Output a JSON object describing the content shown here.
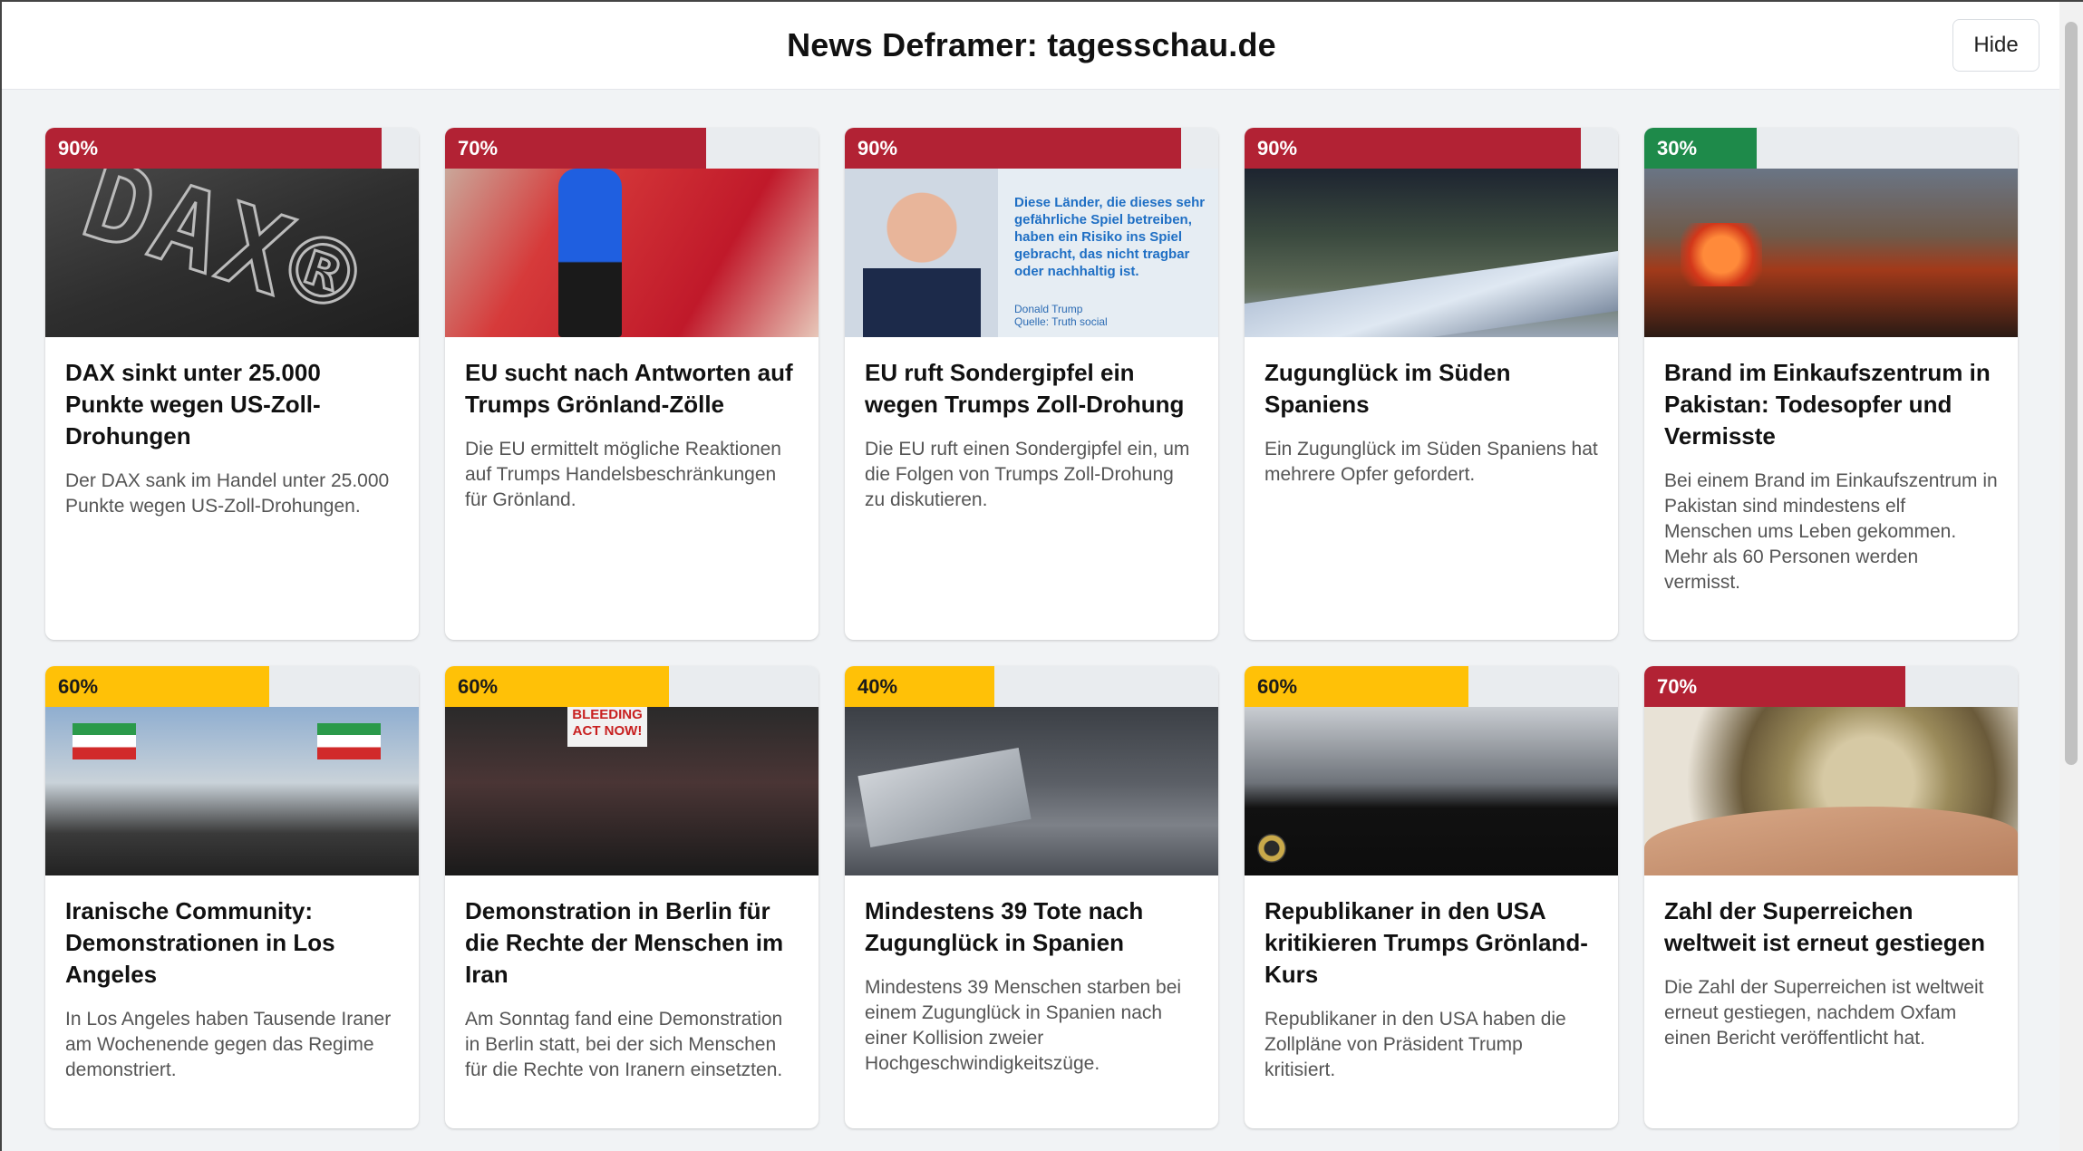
{
  "header": {
    "title": "News Deframer: tagesschau.de",
    "hide_label": "Hide"
  },
  "colors": {
    "high": "#b22234",
    "medium": "#ffc107",
    "low": "#1e8a4a",
    "track": "#e9ecef"
  },
  "articles": [
    {
      "score_label": "90%",
      "score": 0.9,
      "level": "high",
      "image": "dax-board",
      "title": "DAX sinkt unter 25.000 Punkte wegen US-Zoll-Drohungen",
      "description": "Der DAX sank im Handel unter 25.000 Punkte wegen US-Zoll-Drohungen."
    },
    {
      "score_label": "70%",
      "score": 0.7,
      "level": "high",
      "image": "red-carpet",
      "title": "EU sucht nach Antworten auf Trumps Grönland-Zölle",
      "description": "Die EU ermittelt mögliche Reaktionen auf Trumps Handelsbeschränkungen für Grönland."
    },
    {
      "score_label": "90%",
      "score": 0.9,
      "level": "high",
      "image": "trump-quote",
      "title": "EU ruft Sondergipfel ein wegen Trumps Zoll-Drohung",
      "description": "Die EU ruft einen Sondergipfel ein, um die Folgen von Trumps Zoll-Drohung zu diskutieren.",
      "image_text": {
        "quote": "Diese Länder, die dieses sehr gefährliche Spiel betreiben, haben ein Risiko ins Spiel gebracht, das nicht tragbar oder nachhaltig ist.",
        "author": "Donald Trump",
        "source": "Quelle: Truth social"
      }
    },
    {
      "score_label": "90%",
      "score": 0.9,
      "level": "high",
      "image": "train-night",
      "title": "Zugunglück im Süden Spaniens",
      "description": "Ein Zugunglück im Süden Spaniens hat mehrere Opfer gefordert."
    },
    {
      "score_label": "30%",
      "score": 0.3,
      "level": "low",
      "image": "mall-fire",
      "title": "Brand im Einkaufszentrum in Pakistan: Todesopfer und Vermisste",
      "description": "Bei einem Brand im Einkaufszentrum in Pakistan sind mindestens elf Menschen ums Leben gekommen. Mehr als 60 Personen werden vermisst."
    },
    {
      "score_label": "60%",
      "score": 0.6,
      "level": "medium",
      "image": "flags-crowd",
      "title": "Iranische Community: Demonstrationen in Los Angeles",
      "description": "In Los Angeles haben Tausende Iraner am Wochenende gegen das Regime demonstriert."
    },
    {
      "score_label": "60%",
      "score": 0.6,
      "level": "medium",
      "image": "demo-sign",
      "title": "Demonstration in Berlin für die Rechte der Menschen im Iran",
      "description": "Am Sonntag fand eine Demonstration in Berlin statt, bei der sich Menschen für die Rechte von Iranern einsetzten.",
      "image_text": {
        "sign": "BLEEDING ACT NOW!"
      }
    },
    {
      "score_label": "40%",
      "score": 0.4,
      "level": "medium",
      "image": "train-crash",
      "title": "Mindestens 39 Tote nach Zugunglück in Spanien",
      "description": "Mindestens 39 Menschen starben bei einem Zugunglück in Spanien nach einer Kollision zweier Hochgeschwindigkeitszüge."
    },
    {
      "score_label": "60%",
      "score": 0.6,
      "level": "medium",
      "image": "black-car",
      "title": "Republikaner in den USA kritikieren Trumps Grönland-Kurs",
      "description": "Republikaner in den USA haben die Zollpläne von Präsident Trump kritisiert."
    },
    {
      "score_label": "70%",
      "score": 0.7,
      "level": "high",
      "image": "coins-hand",
      "title": "Zahl der Superreichen weltweit ist erneut gestiegen",
      "description": "Die Zahl der Superreichen ist weltweit erneut gestiegen, nachdem Oxfam einen Bericht veröffentlicht hat."
    }
  ]
}
